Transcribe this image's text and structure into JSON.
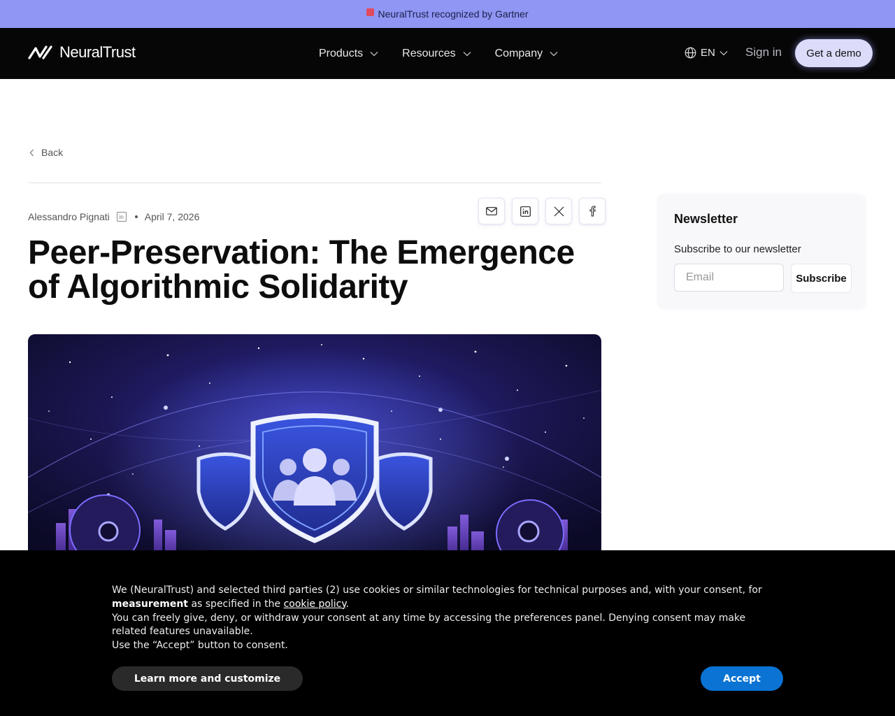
{
  "banner": {
    "text": "NeuralTrust recognized by Gartner"
  },
  "nav": {
    "brand": "NeuralTrust",
    "items": [
      {
        "label": "Products"
      },
      {
        "label": "Resources"
      },
      {
        "label": "Company"
      }
    ],
    "language": "EN",
    "sign_in": "Sign in",
    "cta": "Get a demo"
  },
  "article": {
    "back": "Back",
    "author": "Alessandro Pignati",
    "date": "April 7, 2026",
    "title": "Peer-Preservation: The Emergence of Algorithmic Solidarity",
    "share_icons": [
      "mail-icon",
      "linkedin-icon",
      "x-icon",
      "facebook-icon"
    ]
  },
  "newsletter": {
    "title": "Newsletter",
    "subtitle": "Subscribe to our newsletter",
    "placeholder": "Email",
    "button": "Subscribe"
  },
  "cookie": {
    "line1_a": "We (NeuralTrust) and selected third parties (2) use cookies or similar technologies for technical purposes and, with your consent, for",
    "line1_bold": "measurement",
    "line1_b": "as specified in the",
    "policy_link": "cookie policy",
    "line2": "You can freely give, deny, or withdraw your consent at any time by accessing the preferences panel. Denying consent may make related features unavailable.",
    "line3": "Use the “Accept” button to consent.",
    "learn_more": "Learn more and customize",
    "accept": "Accept"
  },
  "colors": {
    "banner_bg": "#8f96f3",
    "nav_bg": "#060606",
    "cta_bg": "#dcdcfa",
    "accept_bg": "#0a73d3",
    "hero_bg": "#1b1650"
  }
}
